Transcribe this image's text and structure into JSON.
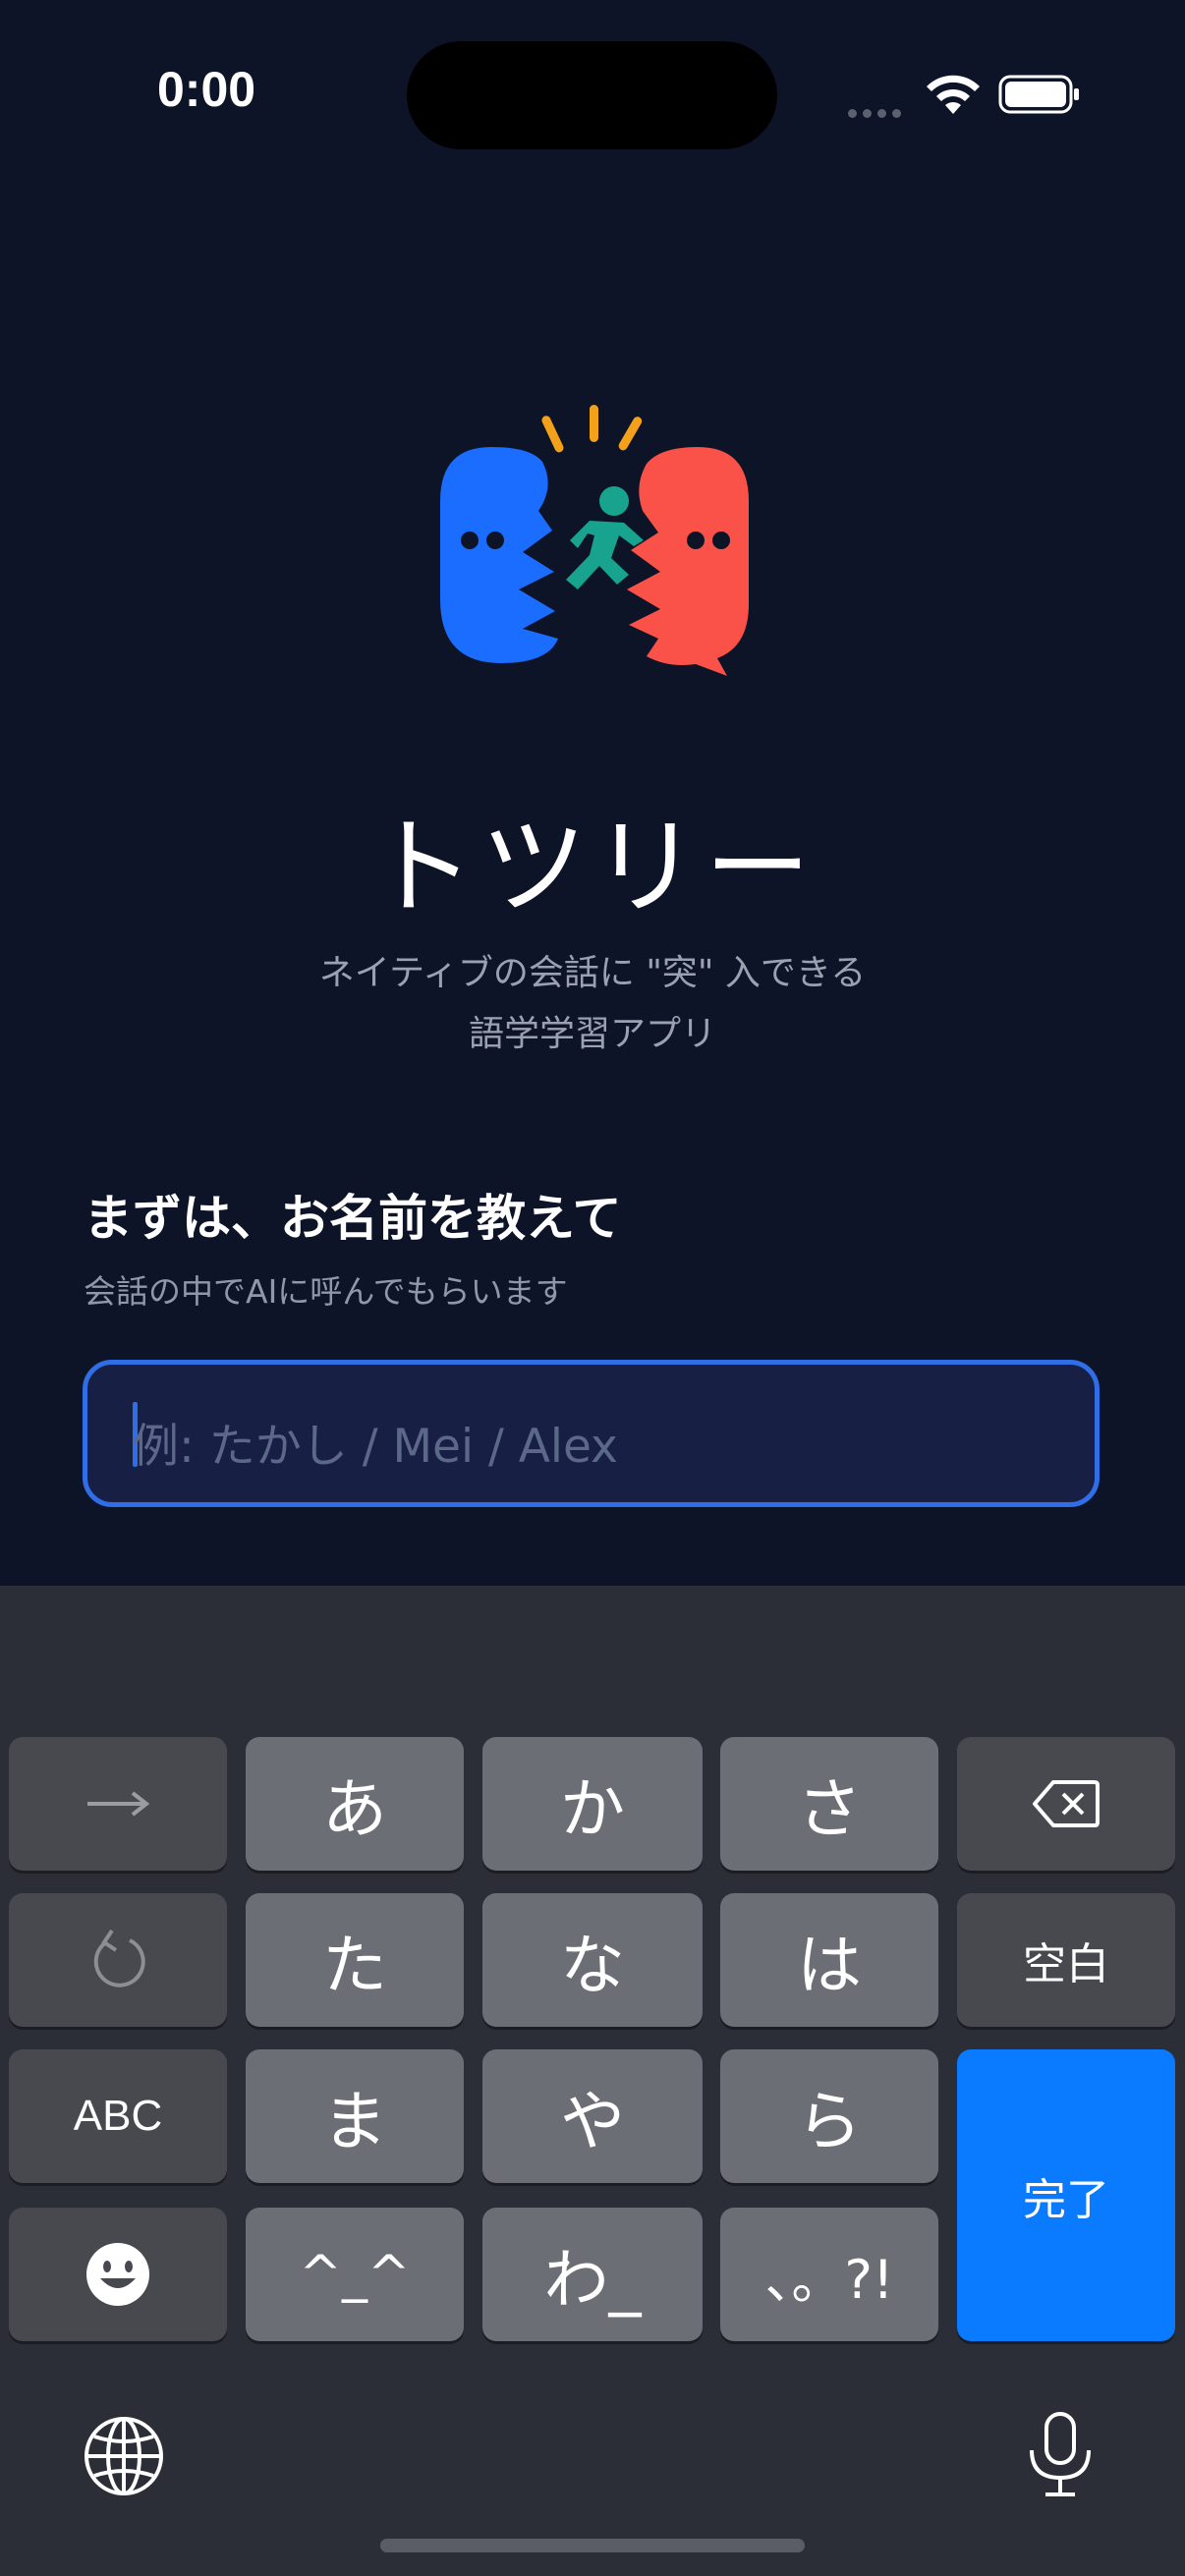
{
  "status_bar": {
    "time": "0:00"
  },
  "app": {
    "title": "トツリー",
    "tagline_line1": "ネイティブの会話に \"突\" 入できる",
    "tagline_line2": "語学学習アプリ"
  },
  "name_prompt": {
    "heading": "まずは、お名前を教えて",
    "subtext": "会話の中でAIに呼んでもらいます",
    "input_value": "",
    "input_placeholder": "例: たかし / Mei / Alex"
  },
  "keyboard": {
    "row1": [
      "→",
      "あ",
      "か",
      "さ"
    ],
    "row2": [
      "た",
      "な",
      "は",
      "空白"
    ],
    "row3": [
      "ABC",
      "ま",
      "や",
      "ら"
    ],
    "row4": [
      "^_^",
      "わ_",
      "、。?!"
    ],
    "done_label": "完了",
    "icons": {
      "arrow": "arrow-right-icon",
      "undo": "undo-icon",
      "delete": "delete-backward-icon",
      "emoji": "emoji-icon",
      "globe": "globe-icon",
      "mic": "microphone-icon"
    }
  },
  "colors": {
    "background": "#0e1427",
    "input_border": "#2f6ee6",
    "logo_blue": "#1a6dff",
    "logo_red": "#fa5248",
    "logo_green": "#17a38e",
    "logo_orange": "#f3a11b",
    "done_key": "#0a7aff"
  }
}
